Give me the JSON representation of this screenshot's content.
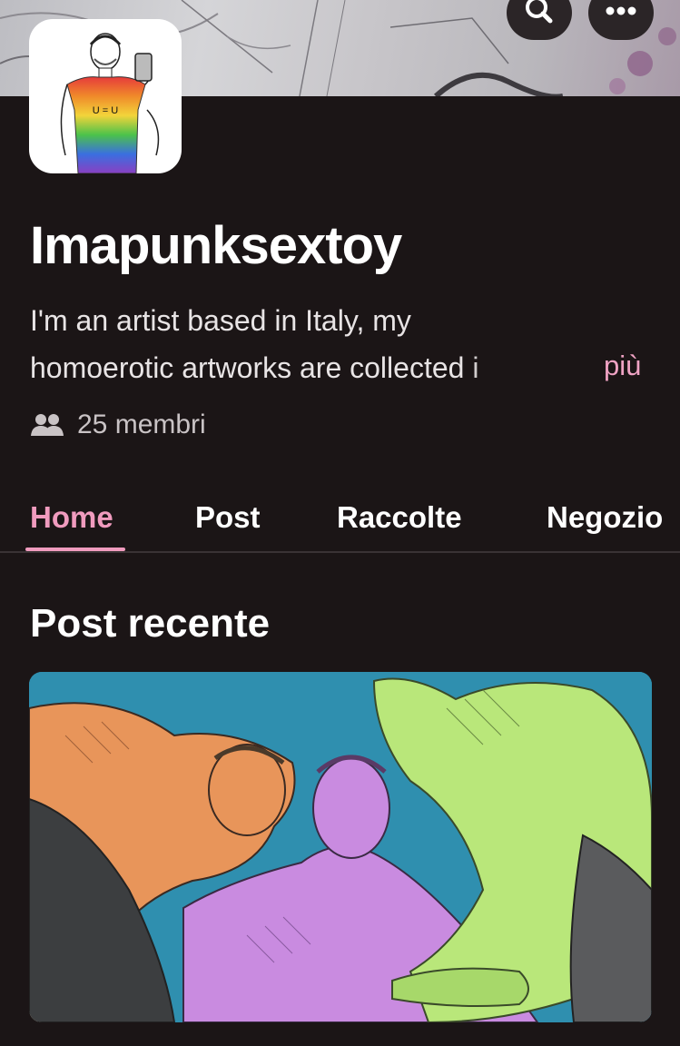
{
  "header": {
    "search_icon": "search-icon",
    "more_icon": "more-dots-icon"
  },
  "profile": {
    "avatar_shirt_text": "U = U",
    "name": "Imapunksextoy",
    "description_line1": "I'm an artist based in Italy, my",
    "description_line2": "homoerotic artworks are collected i",
    "more_label": "più",
    "members_icon": "members-icon",
    "members_text": "25 membri"
  },
  "tabs": [
    {
      "label": "Home",
      "active": true
    },
    {
      "label": "Post",
      "active": false
    },
    {
      "label": "Raccolte",
      "active": false
    },
    {
      "label": "Negozio",
      "active": false
    }
  ],
  "recent": {
    "title": "Post recente"
  },
  "colors": {
    "background": "#1b1516",
    "accent": "#f09bbe",
    "post_bg": "#2f8faf",
    "orange_figure": "#e8955a",
    "violet_figure": "#c98be0",
    "green_figure": "#b9e77a"
  }
}
